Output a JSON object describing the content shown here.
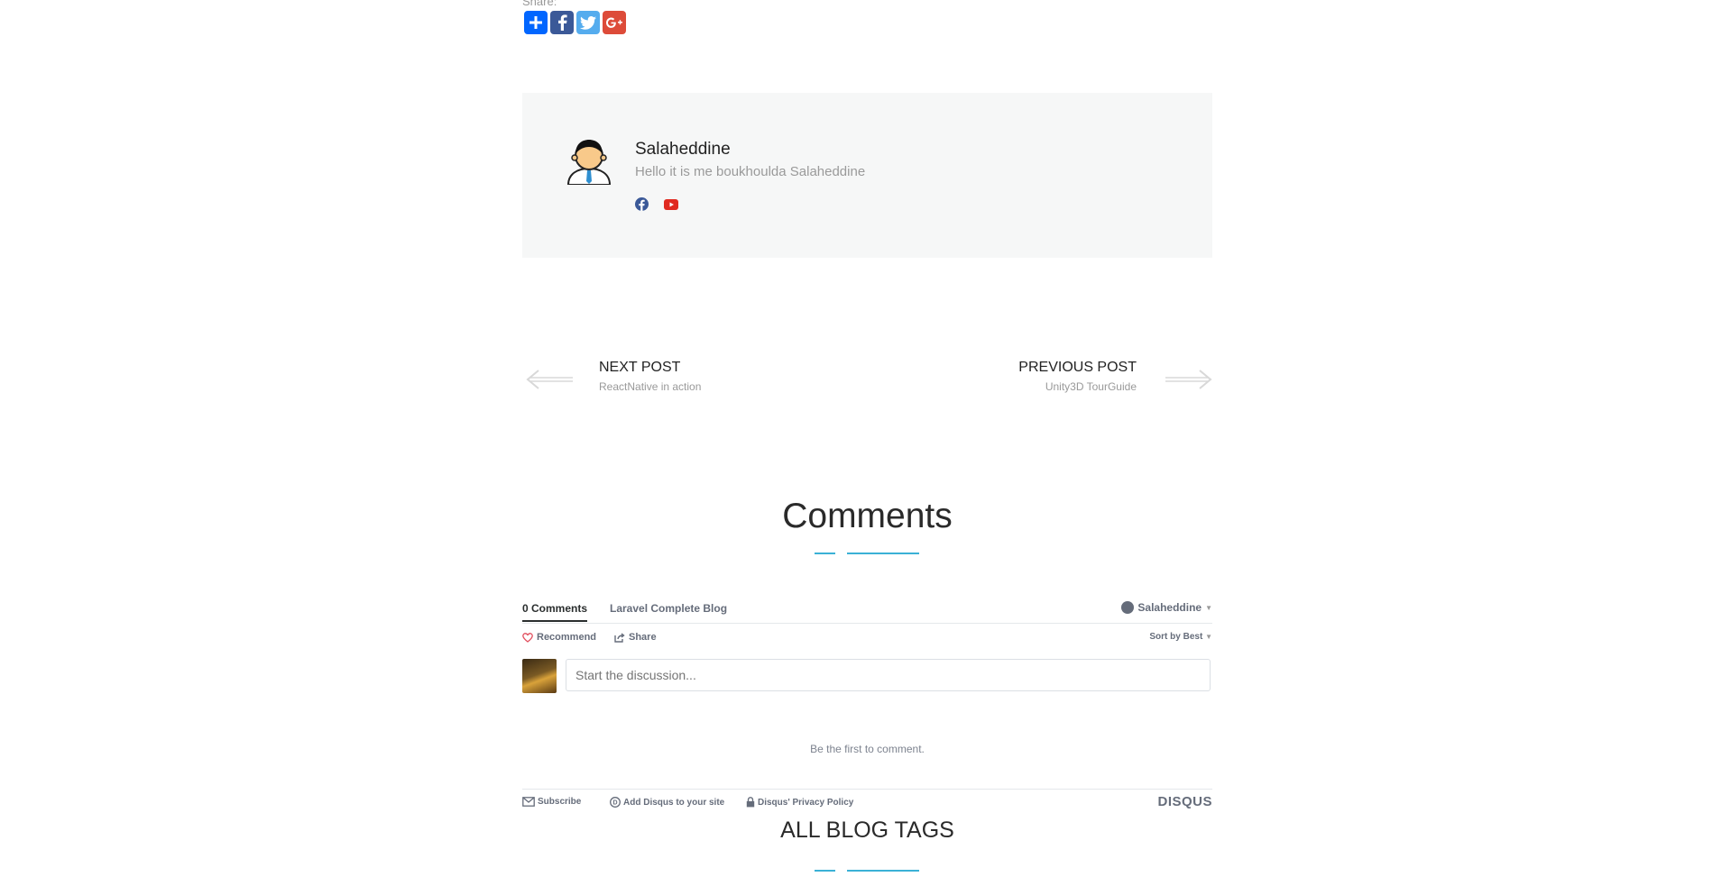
{
  "share": {
    "label": "Share:"
  },
  "author": {
    "name": "Salaheddine",
    "bio": "Hello it is me boukhoulda Salaheddine"
  },
  "post_nav": {
    "next_label": "NEXT POST",
    "next_title": "ReactNative in action",
    "prev_label": "PREVIOUS POST",
    "prev_title": "Unity3D TourGuide"
  },
  "comments": {
    "heading": "Comments",
    "tab_count": "0 Comments",
    "tab_site": "Laravel Complete Blog",
    "user_name": "Salaheddine",
    "recommend_label": "Recommend",
    "share_label": "Share",
    "sort_label": "Sort by Best",
    "input_placeholder": "Start the discussion...",
    "empty_message": "Be the first to comment.",
    "footer": {
      "subscribe": "Subscribe",
      "add_disqus": "Add Disqus to your site",
      "privacy": "Disqus' Privacy Policy",
      "brand": "DISQUS"
    }
  },
  "tags": {
    "heading": "ALL BLOG TAGS"
  },
  "colors": {
    "accent": "#3bb1d6",
    "facebook": "#3b5998",
    "twitter": "#55acee",
    "google_plus": "#dd4b39",
    "addthis": "#0166ff",
    "youtube": "#e02a20"
  }
}
